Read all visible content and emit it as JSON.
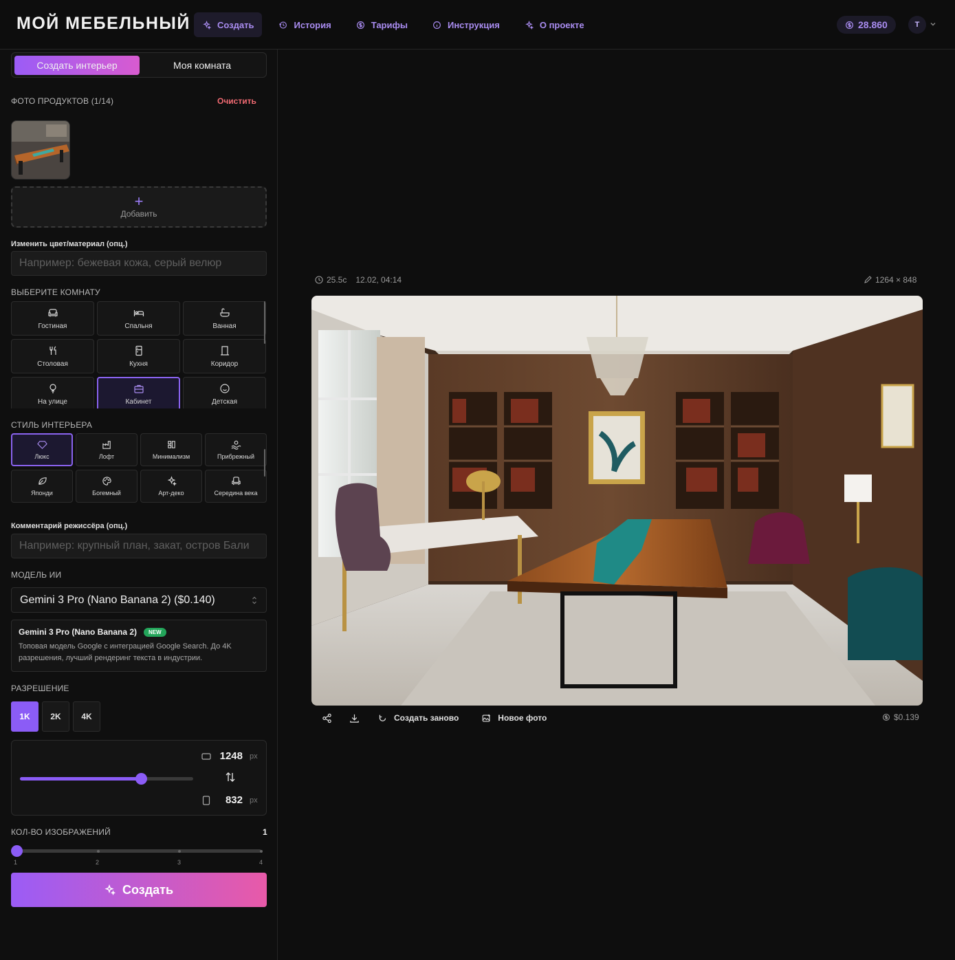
{
  "app": {
    "logo": "МОЙ МЕБЕЛЬНЫЙ",
    "nav": [
      {
        "label": "Создать",
        "icon": "sparkles-icon",
        "active": true
      },
      {
        "label": "История",
        "icon": "history-icon",
        "active": false
      },
      {
        "label": "Тарифы",
        "icon": "coin-icon",
        "active": false
      },
      {
        "label": "Инструкция",
        "icon": "info-icon",
        "active": false
      },
      {
        "label": "О проекте",
        "icon": "sparkles-icon",
        "active": false
      }
    ],
    "balance": "28.860",
    "avatar_initial": "T",
    "accent_color": "#8b5cf6"
  },
  "sidebar": {
    "mode_tabs": [
      "Создать интерьер",
      "Моя комната"
    ],
    "products_label": "ФОТО ПРОДУКТОВ (1/14)",
    "clear_label": "Очистить",
    "add_label": "Добавить",
    "color_label": "Изменить цвет/материал (опц.)",
    "color_placeholder": "Например: бежевая кожа, серый велюр",
    "room_label": "ВЫБЕРИТЕ КОМНАТУ",
    "rooms": [
      {
        "label": "Гостиная",
        "icon": "sofa-icon"
      },
      {
        "label": "Спальня",
        "icon": "bed-icon"
      },
      {
        "label": "Ванная",
        "icon": "bath-icon"
      },
      {
        "label": "Столовая",
        "icon": "utensils-icon"
      },
      {
        "label": "Кухня",
        "icon": "fridge-icon"
      },
      {
        "label": "Коридор",
        "icon": "door-icon"
      },
      {
        "label": "На улице",
        "icon": "tree-icon"
      },
      {
        "label": "Кабинет",
        "icon": "briefcase-icon",
        "selected": true
      },
      {
        "label": "Детская",
        "icon": "smile-icon"
      }
    ],
    "style_label": "СТИЛЬ ИНТЕРЬЕРА",
    "styles": [
      {
        "label": "Люкс",
        "icon": "gem-icon",
        "selected": true
      },
      {
        "label": "Лофт",
        "icon": "factory-icon"
      },
      {
        "label": "Минимализм",
        "icon": "square-icon"
      },
      {
        "label": "Прибрежный",
        "icon": "wave-icon"
      },
      {
        "label": "Японди",
        "icon": "leaf-icon"
      },
      {
        "label": "Богемный",
        "icon": "palette-icon"
      },
      {
        "label": "Арт-деко",
        "icon": "sparkles-icon"
      },
      {
        "label": "Середина века",
        "icon": "armchair-icon"
      }
    ],
    "comment_label": "Комментарий режиссёра (опц.)",
    "comment_placeholder": "Например: крупный план, закат, остров Бали",
    "model_label": "МОДЕЛЬ ИИ",
    "model_selected": "Gemini 3 Pro (Nano Banana 2) ($0.140)",
    "model_info_name": "Gemini 3 Pro (Nano Banana 2)",
    "model_info_badge": "NEW",
    "model_info_desc": "Топовая модель Google с интеграцией Google Search. До 4K разрешения, лучший рендеринг текста в индустрии.",
    "resolution_label": "РАЗРЕШЕНИЕ",
    "resolutions": [
      "1K",
      "2K",
      "4K"
    ],
    "resolution_active": "1K",
    "width": "1248",
    "height": "832",
    "unit": "px",
    "aspect_slider_fraction": 0.7,
    "count_label": "КОЛ-ВО ИЗОБРАЖЕНИЙ",
    "count_value": "1",
    "count_ticks": [
      "1",
      "2",
      "3",
      "4"
    ],
    "create_label": "Создать"
  },
  "main": {
    "duration": "25.5с",
    "timestamp": "12.02, 04:14",
    "dimensions": "1264 × 848",
    "actions": {
      "regenerate": "Создать заново",
      "new_photo": "Новое фото"
    },
    "cost": "$0.139"
  }
}
